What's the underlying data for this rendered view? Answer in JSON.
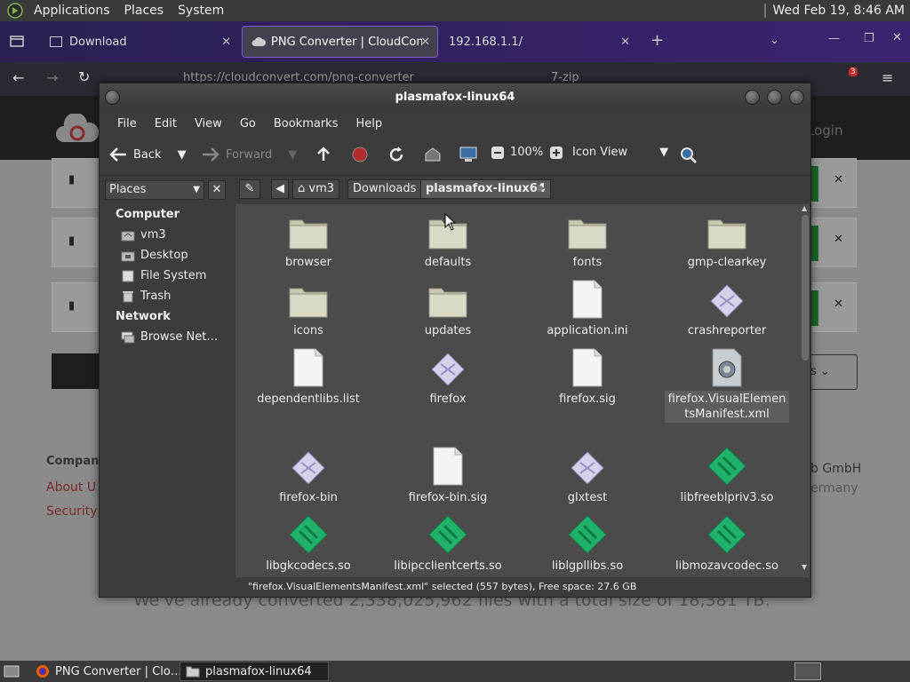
{
  "topbar": {
    "menus": [
      "Applications",
      "Places",
      "System"
    ],
    "clock": "Wed Feb 19,  8:46 AM"
  },
  "browser": {
    "tabs": [
      {
        "label": "Download"
      },
      {
        "label": "PNG Converter | CloudConvert"
      },
      {
        "label": "192.168.1.1/"
      }
    ],
    "url": "https://cloudconvert.com/png-converter",
    "search": "7-zip",
    "badge": "3"
  },
  "page": {
    "login": "Login",
    "company_heading": "Compan",
    "links": [
      "About U",
      "Security"
    ],
    "right_text": [
      "b GmbH",
      "ermany"
    ],
    "converted_text": "We've already converted 2,338,025,962 files with a total size of 18,381 TB.",
    "button_partial": "es"
  },
  "window": {
    "title": "plasmafox-linux64",
    "menu": [
      "File",
      "Edit",
      "View",
      "Go",
      "Bookmarks",
      "Help"
    ],
    "toolbar": {
      "back": "Back",
      "forward": "Forward",
      "zoom": "100%",
      "view_mode": "Icon View"
    },
    "sidebar": {
      "selector": "Places",
      "computer_heading": "Computer",
      "computer_items": [
        "vm3",
        "Desktop",
        "File System",
        "Trash"
      ],
      "network_heading": "Network",
      "network_items": [
        "Browse Net…"
      ]
    },
    "path": [
      "vm3",
      "Downloads",
      "plasmafox-linux64"
    ],
    "files": [
      {
        "name": "browser",
        "icon": "folder-icon"
      },
      {
        "name": "defaults",
        "icon": "folder-icon"
      },
      {
        "name": "fonts",
        "icon": "folder-icon"
      },
      {
        "name": "gmp-clearkey",
        "icon": "folder-icon"
      },
      {
        "name": "icons",
        "icon": "folder-icon"
      },
      {
        "name": "updates",
        "icon": "folder-icon"
      },
      {
        "name": "application.ini",
        "icon": "document-icon"
      },
      {
        "name": "crashreporter",
        "icon": "executable-icon"
      },
      {
        "name": "dependentlibs.list",
        "icon": "document-icon"
      },
      {
        "name": "firefox",
        "icon": "executable-icon"
      },
      {
        "name": "firefox.sig",
        "icon": "document-icon"
      },
      {
        "name": "firefox.VisualElementsManifest.xml",
        "icon": "xml-icon"
      },
      {
        "name": "firefox-bin",
        "icon": "executable-icon"
      },
      {
        "name": "firefox-bin.sig",
        "icon": "document-icon"
      },
      {
        "name": "glxtest",
        "icon": "executable-icon"
      },
      {
        "name": "libfreeblpriv3.so",
        "icon": "library-icon"
      },
      {
        "name": "libgkcodecs.so",
        "icon": "library-icon"
      },
      {
        "name": "libipcclientcerts.so",
        "icon": "library-icon"
      },
      {
        "name": "liblgpllibs.so",
        "icon": "library-icon"
      },
      {
        "name": "libmozavcodec.so",
        "icon": "library-icon"
      }
    ],
    "selected": "firefox.VisualElementsManifest.xml",
    "status": "\"firefox.VisualElementsManifest.xml\" selected (557 bytes), Free space: 27.6 GB"
  },
  "taskbar": {
    "tasks": [
      "PNG Converter | Clo…",
      "plasmafox-linux64"
    ]
  }
}
